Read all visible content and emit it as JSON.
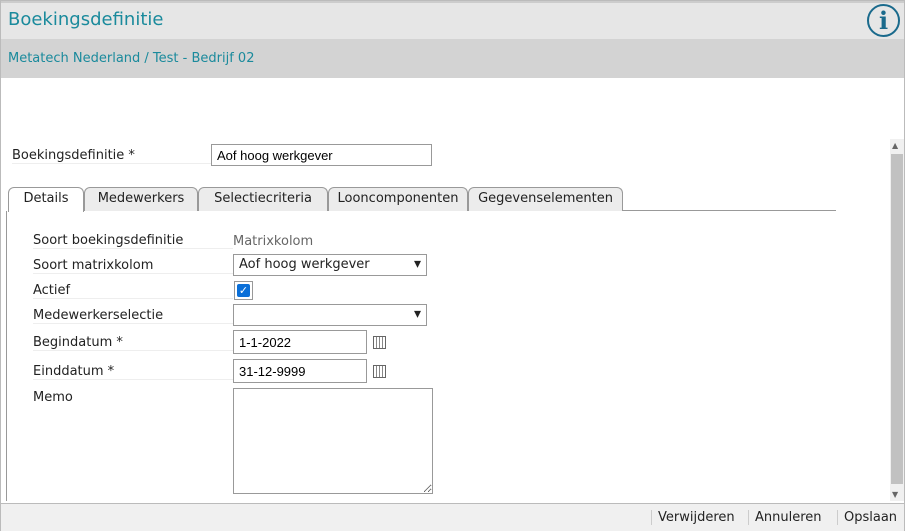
{
  "header": {
    "title": "Boekingsdefinitie",
    "info_icon": "info-icon"
  },
  "breadcrumb": "Metatech Nederland / Test - Bedrijf 02",
  "name_field": {
    "label": "Boekingsdefinitie *",
    "value": "Aof hoog werkgever"
  },
  "tabs": [
    "Details",
    "Medewerkers",
    "Selectiecriteria",
    "Looncomponenten",
    "Gegevenselementen"
  ],
  "fields": {
    "soort_label": "Soort boekingsdefinitie",
    "soort_value": "Matrixkolom",
    "matrix_label": "Soort matrixkolom",
    "matrix_value": "Aof hoog werkgever",
    "actief_label": "Actief",
    "actief_checked": true,
    "selectie_label": "Medewerkerselectie",
    "selectie_value": "",
    "begin_label": "Begindatum *",
    "begin_value": "1-1-2022",
    "eind_label": "Einddatum *",
    "eind_value": "31-12-9999",
    "memo_label": "Memo",
    "memo_value": ""
  },
  "footer": {
    "delete": "Verwijderen",
    "cancel": "Annuleren",
    "save": "Opslaan"
  }
}
